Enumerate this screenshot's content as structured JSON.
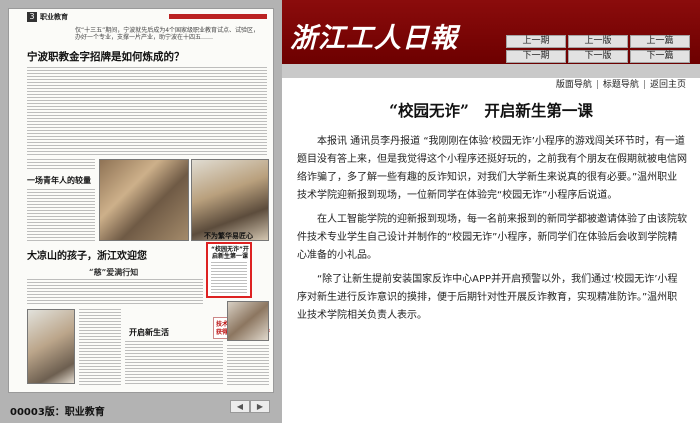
{
  "newspaper": {
    "title": "浙江工人日報",
    "nav": {
      "prev_issue": "上一期",
      "next_issue": "下一期",
      "prev_page": "上一版",
      "next_page": "下一版",
      "prev_article": "上一篇",
      "next_article": "下一篇"
    },
    "links": [
      "版面导航",
      "标题导航",
      "返回主页"
    ]
  },
  "article": {
    "title": "“校园无诈”　开启新生第一课",
    "paragraphs": [
      "本报讯 通讯员李丹报道 “我刚刚在体验‘校园无诈’小程序的游戏闯关环节时，有一道题目没有答上来，但是我觉得这个小程序还挺好玩的，之前我有个朋友在假期就被电信网络诈骗了，多了解一些有趣的反诈知识，对我们大学新生来说真的很有必要。”温州职业技术学院迎新报到现场，一位新同学在体验完“校园无诈”小程序后说道。",
      "在人工智能学院的迎新报到现场，每一名前来报到的新同学都被邀请体验了由该院软件技术专业学生自己设计并制作的“校园无诈”小程序，新同学们在体验后会收到学院精心准备的小礼品。",
      "“除了让新生提前安装国家反诈中心APP并开启预警以外，我们通过‘校园无诈’小程序对新生进行反诈意识的摸排，便于后期针对性开展反诈教育，实现精准防诈。”温州职业技术学院相关负责人表示。"
    ]
  },
  "page_preview": {
    "page_number": "3",
    "section": "职业教育",
    "lead": "仅“十三五”期间，宁波就先后成为4个国家级职业教育试点、试验区，办好一个专业，支撑一片产业，助宁波在十四五……",
    "headline": "宁波职教金字招牌是如何炼成的？",
    "sub1": "一场青年人的较量",
    "sub2": "大凉山的孩子，浙江欢迎您",
    "sub3": "“慈”爱满行知",
    "sub4": "开启新生活",
    "sub5": "不为繁华易匠心",
    "highlight": "“校园无诈”开启新生第一课",
    "red1": "技术技能助推团队",
    "red2": "获得了台州市级荣誉"
  },
  "footer": {
    "issue_label": "00003版：职业教育",
    "prev_arrow": "◀",
    "next_arrow": "▶"
  }
}
